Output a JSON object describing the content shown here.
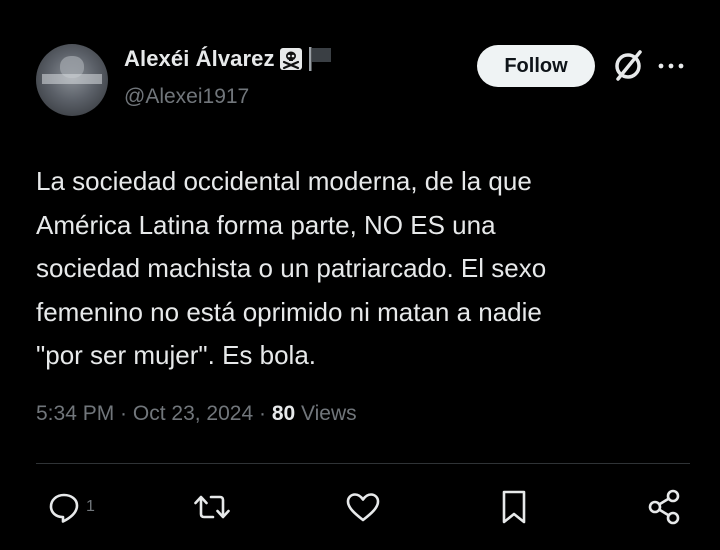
{
  "author": {
    "display_name": "Alexéi Álvarez",
    "name_emoji": [
      "skull-and-crossbones-icon",
      "black-flag-icon"
    ],
    "handle": "@Alexei1917"
  },
  "header": {
    "follow_label": "Follow",
    "icons": [
      "grok-icon",
      "more-options-icon"
    ]
  },
  "tweet": {
    "text": "La sociedad occidental moderna, de la que\nAmérica Latina forma parte, NO ES una\nsociedad machista o un patriarcado. El sexo\nfemenino no está oprimido ni matan a nadie\n\"por ser mujer\". Es bola.",
    "time": "5:34 PM",
    "separator": " · ",
    "date": "Oct 23, 2024",
    "views_count": "80",
    "views_label": "Views"
  },
  "actions": {
    "reply_count": "1",
    "icons": [
      "reply-icon",
      "retweet-icon",
      "like-icon",
      "bookmark-icon",
      "share-icon"
    ]
  },
  "colors": {
    "background": "#000000",
    "text_primary": "#e7e9ea",
    "text_secondary": "#71767b",
    "follow_bg": "#eff3f4",
    "divider": "#2f3336"
  }
}
